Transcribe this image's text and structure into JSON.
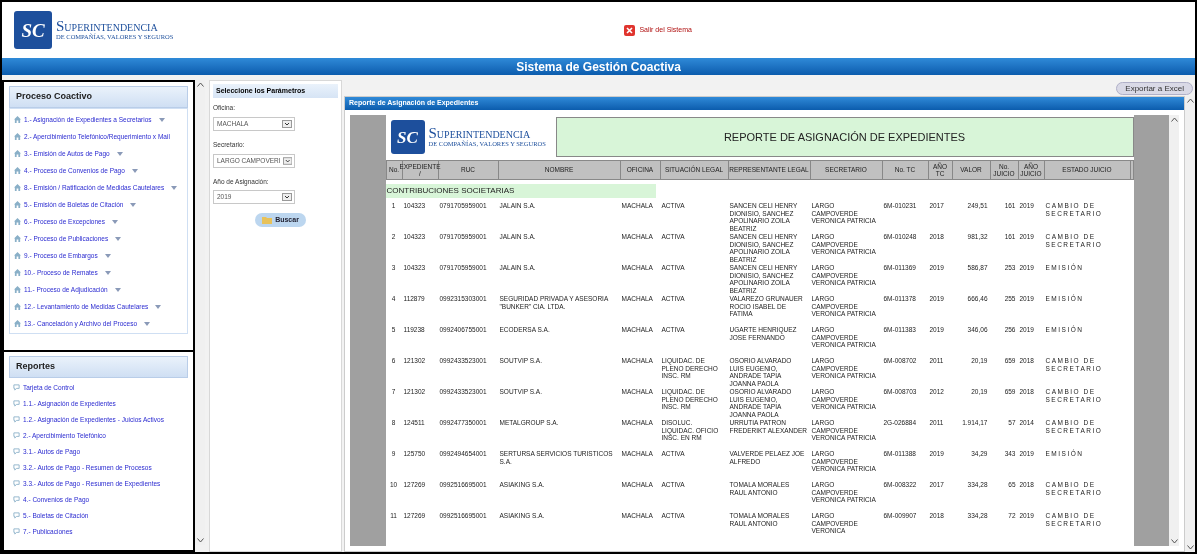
{
  "header": {
    "logo": {
      "mark": "SC",
      "name": "SUPERINTENDENCIA",
      "subtitle": "DE COMPAÑÍAS, VALORES Y SEGUROS"
    },
    "logout": "Salir del Sistema",
    "banner": "Sistema de Gestión Coactiva"
  },
  "sidebar": [
    {
      "title": "Proceso Coactivo",
      "kind": "process",
      "items": [
        {
          "label": "1.- Asignación de Expedientes a Secretarios",
          "has_menu": true
        },
        {
          "label": "2.- Apercibimiento Telefónico/Requerimiento x Mail",
          "has_menu": false
        },
        {
          "label": "3.- Emisión de Autos de Pago",
          "has_menu": true
        },
        {
          "label": "4.- Proceso de Convenios de Pago",
          "has_menu": true
        },
        {
          "label": "8.- Emisión / Ratificación de Medidas Cautelares",
          "has_menu": true
        },
        {
          "label": "5.- Emisión de Boletas de Citación",
          "has_menu": true
        },
        {
          "label": "6.- Proceso de Excepciones",
          "has_menu": true
        },
        {
          "label": "7.- Proceso de Publicaciones",
          "has_menu": true
        },
        {
          "label": "9.- Proceso de Embargos",
          "has_menu": true
        },
        {
          "label": "10.- Proceso de Remates",
          "has_menu": true
        },
        {
          "label": "11.- Proceso de Adjudicación",
          "has_menu": true
        },
        {
          "label": "12.- Levantamiento de Medidas Cautelares",
          "has_menu": true
        },
        {
          "label": "13.- Cancelación y Archivo del Proceso",
          "has_menu": true
        }
      ]
    },
    {
      "title": "Reportes",
      "kind": "report",
      "items": [
        {
          "label": "Tarjeta de Control",
          "has_menu": false
        },
        {
          "label": "1.1.- Asignación de Expedientes",
          "has_menu": false
        },
        {
          "label": "1.2.- Asignación de Expedientes - Juicios Activos",
          "has_menu": false
        },
        {
          "label": "2.- Apercibimiento Telefónico",
          "has_menu": false
        },
        {
          "label": "3.1.- Autos de Pago",
          "has_menu": false
        },
        {
          "label": "3.2.- Autos de Pago - Resumen de Procesos",
          "has_menu": false
        },
        {
          "label": "3.3.- Autos de Pago - Resumen de Expedientes",
          "has_menu": false
        },
        {
          "label": "4.- Convenios de Pago",
          "has_menu": false
        },
        {
          "label": "5.- Boletas de Citación",
          "has_menu": false
        },
        {
          "label": "7.- Publicaciones",
          "has_menu": false
        }
      ]
    }
  ],
  "params": {
    "title": "Seleccione los Parámetros",
    "fields": [
      {
        "label": "Oficina:",
        "value": "MACHALA"
      },
      {
        "label": "Secretario:",
        "value": "LARGO CAMPOVERI"
      },
      {
        "label": "Año de Asignación:",
        "value": "2019"
      }
    ],
    "button": "Buscar"
  },
  "report": {
    "logo": {
      "mark": "SC",
      "name": "SUPERINTENDENCIA",
      "subtitle": "DE COMPAÑÍAS, VALORES Y SEGUROS"
    },
    "export": "Exportar a Excel",
    "panel_title": "Reporte de Asignación de Expedientes",
    "title": "REPORTE DE ASIGNACIÓN DE EXPEDIENTES",
    "columns": [
      "No.",
      "EXPEDIENTE /",
      "RUC",
      "NOMBRE",
      "OFICINA",
      "SITUACIÓN LEGAL",
      "REPRESENTANTE LEGAL",
      "SECRETARIO",
      "No. TC",
      "AÑO TC",
      "VALOR",
      "No. JUICIO",
      "AÑO JUICIO",
      "ESTADO JUICIO"
    ],
    "group": "CONTRIBUCIONES SOCIETARIAS",
    "rows": [
      [
        "1",
        "104323",
        "0791705959001",
        "JALAIN S.A.",
        "MACHALA",
        "ACTIVA",
        "SANCEN CELI HENRY DIONISIO, SANCHEZ APOLINARIO ZOILA BEATRIZ",
        "LARGO CAMPOVERDE VERONICA PATRICIA",
        "6M-010231",
        "2017",
        "249,51",
        "161",
        "2019",
        "CAMBIO DE SECRETARIO"
      ],
      [
        "2",
        "104323",
        "0791705959001",
        "JALAIN S.A.",
        "MACHALA",
        "ACTIVA",
        "SANCEN CELI HENRY DIONISIO, SANCHEZ APOLINARIO ZOILA BEATRIZ",
        "LARGO CAMPOVERDE VERONICA PATRICIA",
        "6M-010248",
        "2018",
        "981,32",
        "161",
        "2019",
        "CAMBIO DE SECRETARIO"
      ],
      [
        "3",
        "104323",
        "0791705959001",
        "JALAIN S.A.",
        "MACHALA",
        "ACTIVA",
        "SANCEN CELI HENRY DIONISIO, SANCHEZ APOLINARIO ZOILA BEATRIZ",
        "LARGO CAMPOVERDE VERONICA PATRICIA",
        "6M-011369",
        "2019",
        "586,87",
        "253",
        "2019",
        "EMISIÓN"
      ],
      [
        "4",
        "112879",
        "0992315303001",
        "SEGURIDAD PRIVADA Y ASESORIA \"BUNKER\" CIA. LTDA.",
        "MACHALA",
        "ACTIVA",
        "VALAREZO GRUNAUER ROCIO ISABEL DE FATIMA",
        "LARGO CAMPOVERDE VERONICA PATRICIA",
        "6M-011378",
        "2019",
        "666,46",
        "255",
        "2019",
        "EMISIÓN"
      ],
      [
        "5",
        "119238",
        "0992406755001",
        "ECODERSA S.A.",
        "MACHALA",
        "ACTIVA",
        "UGARTE HENRIQUEZ JOSE FERNANDO",
        "LARGO CAMPOVERDE VERONICA PATRICIA",
        "6M-011383",
        "2019",
        "346,06",
        "256",
        "2019",
        "EMISIÓN"
      ],
      [
        "6",
        "121302",
        "0992433523001",
        "SOUTVIP S.A.",
        "MACHALA",
        "LIQUIDAC. DE PLENO DERECHO INSC. RM",
        "OSORIO ALVARADO LUIS EUGENIO, ANDRADE TAPIA JOANNA PAOLA",
        "LARGO CAMPOVERDE VERONICA PATRICIA",
        "6M-008702",
        "2011",
        "20,19",
        "659",
        "2018",
        "CAMBIO DE SECRETARIO"
      ],
      [
        "7",
        "121302",
        "0992433523001",
        "SOUTVIP S.A.",
        "MACHALA",
        "LIQUIDAC. DE PLENO DERECHO INSC. RM",
        "OSORIO ALVARADO LUIS EUGENIO, ANDRADE TAPIA JOANNA PAOLA",
        "LARGO CAMPOVERDE VERONICA PATRICIA",
        "6M-008703",
        "2012",
        "20,19",
        "659",
        "2018",
        "CAMBIO DE SECRETARIO"
      ],
      [
        "8",
        "124511",
        "0992477350001",
        "METALGROUP S.A.",
        "MACHALA",
        "DISOLUC. LIQUIDAC. OFICIO INSC. EN RM",
        "URRUTIA PATRON FREDERIKT ALEXANDER",
        "LARGO CAMPOVERDE VERONICA PATRICIA",
        "2G-026884",
        "2011",
        "1.914,17",
        "57",
        "2014",
        "CAMBIO DE SECRETARIO"
      ],
      [
        "9",
        "125750",
        "0992494654001",
        "SERTURSA SERVICIOS TURISTICOS S.A.",
        "MACHALA",
        "ACTIVA",
        "VALVERDE PELAEZ JOE ALFREDO",
        "LARGO CAMPOVERDE VERONICA PATRICIA",
        "6M-011388",
        "2019",
        "34,29",
        "343",
        "2019",
        "EMISIÓN"
      ],
      [
        "10",
        "127269",
        "0992516695001",
        "ASIAKING S.A.",
        "MACHALA",
        "ACTIVA",
        "TOMALA MORALES RAUL ANTONIO",
        "LARGO CAMPOVERDE VERONICA PATRICIA",
        "6M-008322",
        "2017",
        "334,28",
        "65",
        "2018",
        "CAMBIO DE SECRETARIO"
      ],
      [
        "11",
        "127269",
        "0992516695001",
        "ASIAKING S.A.",
        "MACHALA",
        "ACTIVA",
        "TOMALA MORALES RAUL ANTONIO",
        "LARGO CAMPOVERDE VERONICA",
        "6M-009907",
        "2018",
        "334,28",
        "72",
        "2019",
        "CAMBIO DE SECRETARIO"
      ]
    ]
  }
}
